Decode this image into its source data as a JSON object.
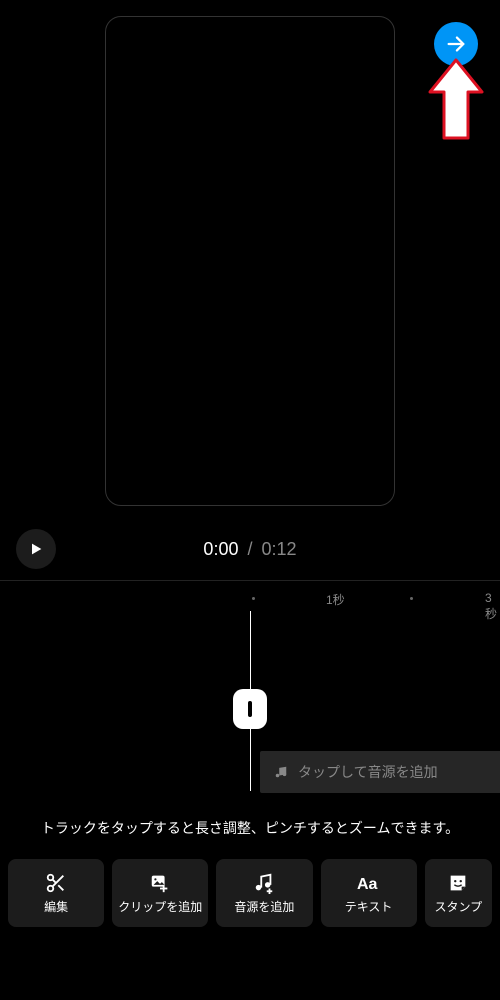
{
  "colors": {
    "accent": "#0095f6"
  },
  "time": {
    "current": "0:00",
    "total": "0:12",
    "separator": "/"
  },
  "ruler": {
    "label1": "1秒",
    "label2": "3秒"
  },
  "audio": {
    "placeholder": "タップして音源を追加"
  },
  "hint": "トラックをタップすると長さ調整、ピンチするとズームできます。",
  "toolbar": {
    "edit": "編集",
    "add_clip": "クリップを追加",
    "add_audio": "音源を追加",
    "text": "テキスト",
    "sticker": "スタンプ"
  }
}
